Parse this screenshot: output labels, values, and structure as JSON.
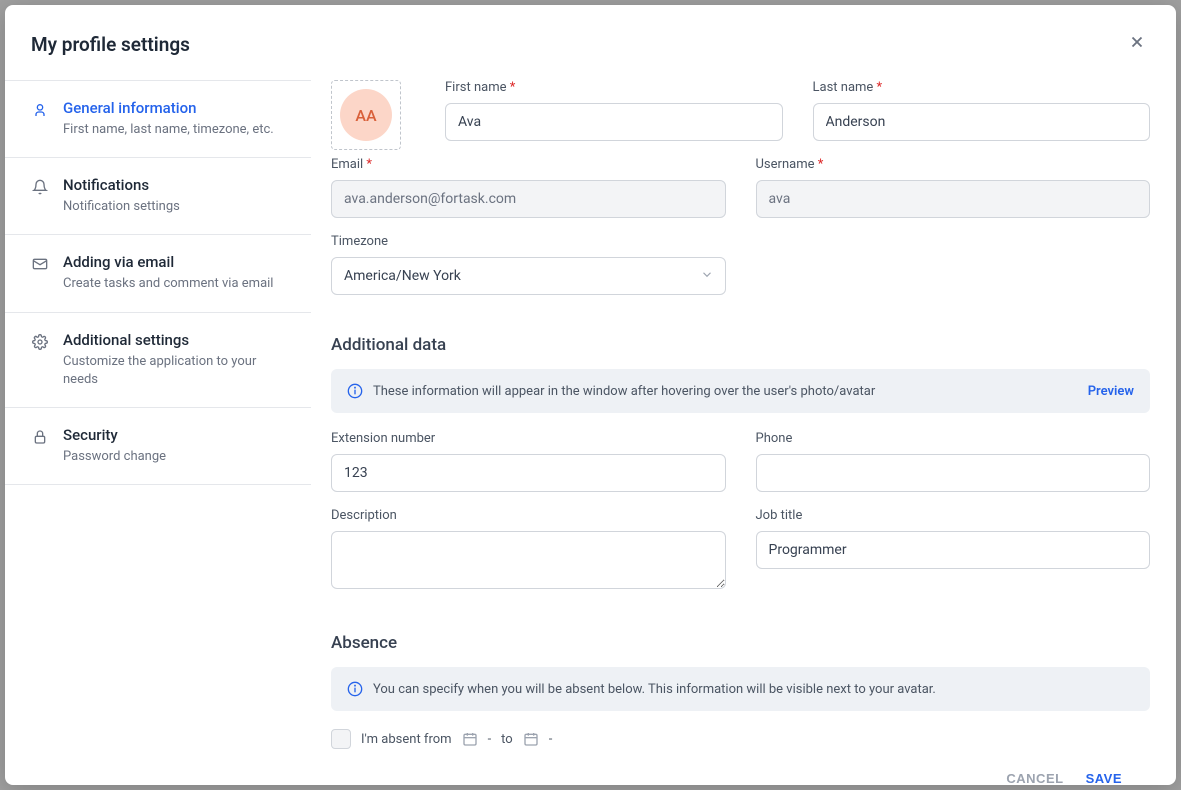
{
  "modal": {
    "title": "My profile settings"
  },
  "sidebar": {
    "items": [
      {
        "title": "General information",
        "desc": "First name, last name, timezone, etc."
      },
      {
        "title": "Notifications",
        "desc": "Notification settings"
      },
      {
        "title": "Adding via email",
        "desc": "Create tasks and comment via email"
      },
      {
        "title": "Additional settings",
        "desc": "Customize the application to your needs"
      },
      {
        "title": "Security",
        "desc": "Password change"
      }
    ]
  },
  "avatar": {
    "initials": "AA"
  },
  "fields": {
    "first_name": {
      "label": "First name",
      "value": "Ava"
    },
    "last_name": {
      "label": "Last name",
      "value": "Anderson"
    },
    "email": {
      "label": "Email",
      "value": "ava.anderson@fortask.com"
    },
    "username": {
      "label": "Username",
      "value": "ava"
    },
    "timezone": {
      "label": "Timezone",
      "value": "America/New York"
    },
    "extension": {
      "label": "Extension number",
      "value": "123"
    },
    "phone": {
      "label": "Phone",
      "value": ""
    },
    "description": {
      "label": "Description",
      "value": ""
    },
    "job_title": {
      "label": "Job title",
      "value": "Programmer"
    }
  },
  "sections": {
    "additional": {
      "title": "Additional data",
      "info": "These information will appear in the window after hovering over the user's photo/avatar",
      "preview": "Preview"
    },
    "absence": {
      "title": "Absence",
      "info": "You can specify when you will be absent below. This information will be visible next to your avatar.",
      "checkbox_label": "I'm absent from",
      "to_label": "to",
      "dash": "-"
    }
  },
  "footer": {
    "cancel": "CANCEL",
    "save": "SAVE"
  }
}
